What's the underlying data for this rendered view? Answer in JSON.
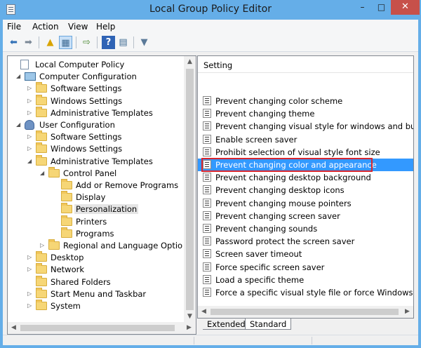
{
  "window": {
    "title": "Local Group Policy Editor",
    "minimize_label": "–",
    "maximize_label": "□",
    "close_label": "✕"
  },
  "menu": [
    "File",
    "Action",
    "View",
    "Help"
  ],
  "toolbar": {
    "back_icon": "⬅",
    "forward_icon": "➡",
    "up_icon": "▲",
    "show_hide_tree_icon": "▦",
    "export_icon": "⇨",
    "help_icon": "?",
    "properties_icon": "▤",
    "filter_icon": "▼"
  },
  "tree": {
    "items": [
      {
        "label": "Local Computer Policy",
        "expander": "",
        "icon": "doc"
      },
      {
        "label": "Computer Configuration",
        "expander": "◢",
        "icon": "computer"
      },
      {
        "label": "Software Settings",
        "expander": "▷",
        "icon": "folder"
      },
      {
        "label": "Windows Settings",
        "expander": "▷",
        "icon": "folder"
      },
      {
        "label": "Administrative Templates",
        "expander": "▷",
        "icon": "folder"
      },
      {
        "label": "User Configuration",
        "expander": "◢",
        "icon": "user"
      },
      {
        "label": "Software Settings",
        "expander": "▷",
        "icon": "folder"
      },
      {
        "label": "Windows Settings",
        "expander": "▷",
        "icon": "folder"
      },
      {
        "label": "Administrative Templates",
        "expander": "◢",
        "icon": "folder"
      },
      {
        "label": "Control Panel",
        "expander": "◢",
        "icon": "folder"
      },
      {
        "label": "Add or Remove Programs",
        "expander": "",
        "icon": "folder"
      },
      {
        "label": "Display",
        "expander": "",
        "icon": "folder"
      },
      {
        "label": "Personalization",
        "expander": "",
        "icon": "folder"
      },
      {
        "label": "Printers",
        "expander": "",
        "icon": "folder"
      },
      {
        "label": "Programs",
        "expander": "",
        "icon": "folder"
      },
      {
        "label": "Regional and Language Optio",
        "expander": "▷",
        "icon": "folder"
      },
      {
        "label": "Desktop",
        "expander": "▷",
        "icon": "folder"
      },
      {
        "label": "Network",
        "expander": "▷",
        "icon": "folder"
      },
      {
        "label": "Shared Folders",
        "expander": "",
        "icon": "folder"
      },
      {
        "label": "Start Menu and Taskbar",
        "expander": "▷",
        "icon": "folder"
      },
      {
        "label": "System",
        "expander": "▷",
        "icon": "folder"
      }
    ],
    "selected_index": 12
  },
  "list": {
    "column_header": "Setting",
    "items": [
      "Prevent changing color scheme",
      "Prevent changing theme",
      "Prevent changing visual style for windows and buttons",
      "Enable screen saver",
      "Prohibit selection of visual style font size",
      "Prevent changing color and appearance",
      "Prevent changing desktop background",
      "Prevent changing desktop icons",
      "Prevent changing mouse pointers",
      "Prevent changing screen saver",
      "Prevent changing sounds",
      "Password protect the screen saver",
      "Screen saver timeout",
      "Force specific screen saver",
      "Load a specific theme",
      "Force a specific visual style file or force Windows Classic"
    ],
    "selected_index": 5
  },
  "scroll": {
    "up": "▲",
    "down": "▼",
    "left": "◀",
    "right": "▶"
  },
  "tabs": [
    "Extended",
    "Standard"
  ],
  "active_tab": "Standard",
  "colors": {
    "titlebar": "#65aee8",
    "selection": "#3399ff",
    "highlight_box": "#d9272e",
    "close_button": "#c7504a"
  }
}
